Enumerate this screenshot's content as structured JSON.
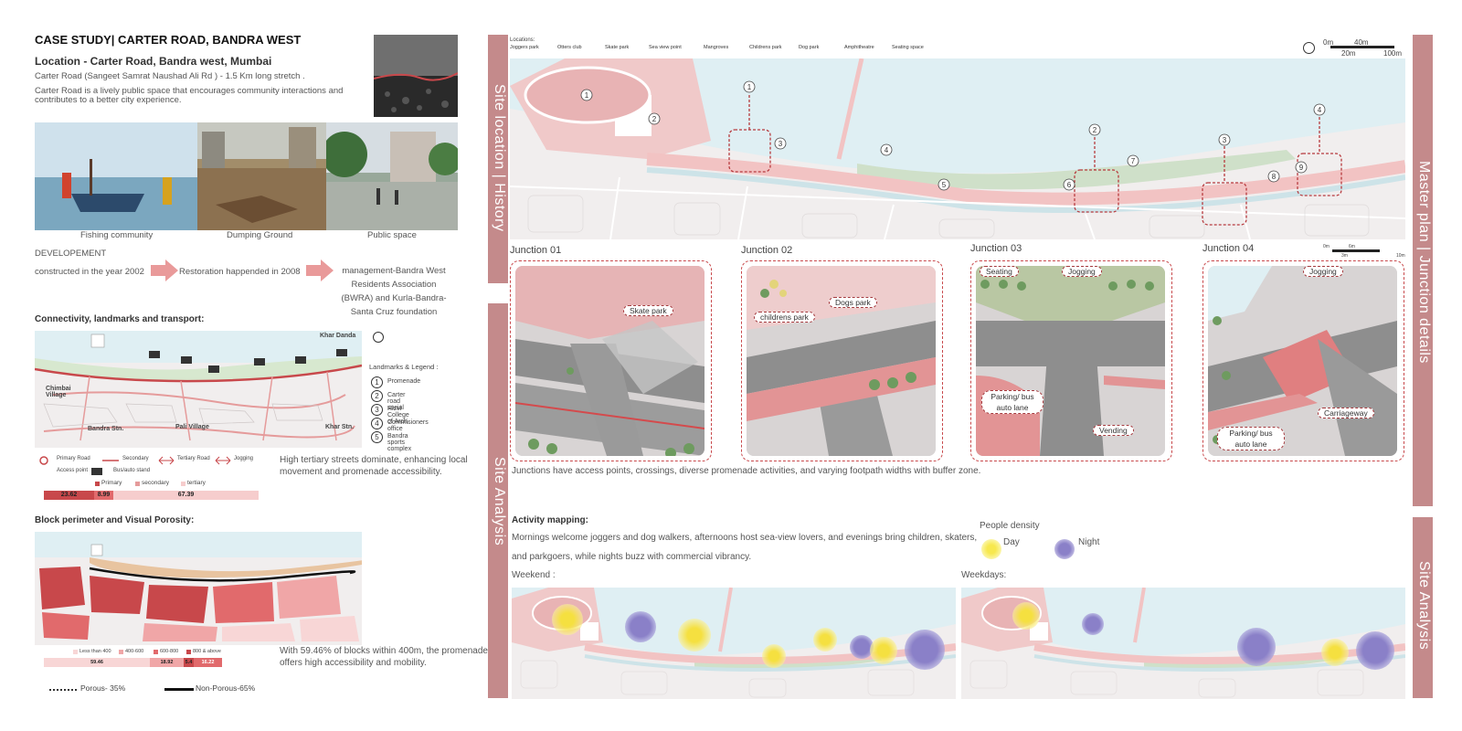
{
  "left": {
    "case_title": "CASE STUDY| CARTER ROAD, BANDRA WEST",
    "location": "Location - Carter Road, Bandra west, Mumbai",
    "road_line": "Carter Road (Sangeet Samrat Naushad Ali Rd ) - 1.5 Km long stretch .",
    "description": "Carter Road is a lively public space that encourages community interactions and contributes to a better city experience.",
    "photos": [
      {
        "caption": "Fishing community"
      },
      {
        "caption": "Dumping Ground"
      },
      {
        "caption": "Public space"
      }
    ],
    "development": {
      "heading": "DEVELOPEMENT",
      "step1": "constructed in the year 2002",
      "step2": "Restoration happended in 2008",
      "step3": "management-Bandra West Residents Association (BWRA) and Kurla-Bandra-Santa Cruz foundation"
    },
    "connectivity": {
      "heading": "Connectivity, landmarks and transport:",
      "legend_title": "Landmarks & Legend :",
      "landmarks": [
        "Promenade",
        "Carter road social",
        "Rizvi College of Arch.",
        "Commisioners office",
        "Bandra sports complex"
      ],
      "map_labels": [
        "Khar Danda",
        "Chimbai Village",
        "Bandra Stn.",
        "Pali Village",
        "Khar Stn."
      ],
      "road_legend": [
        "Primary Road",
        "Secondary",
        "Tertiary Road",
        "Jogging"
      ],
      "access_label": "Access point",
      "bus_label": "Bus/auto stand",
      "bar_legend": [
        "Primary",
        "secondary",
        "tertiary"
      ],
      "bar_values": [
        "23.62",
        "8.99",
        "67.39"
      ],
      "note": "High tertiary streets dominate, enhancing local movement and promenade accessibility."
    },
    "porosity": {
      "heading": "Block perimeter and Visual Porosity:",
      "legend": [
        "Less than 400",
        "400-600",
        "600-800",
        "800 & above"
      ],
      "bar_values": [
        "59.46",
        "18.92",
        "5.4",
        "16.22"
      ],
      "note": "With 59.46% of blocks within 400m, the promenade offers high accessibility and mobility.",
      "porous": "Porous- 35%",
      "non_porous": "Non-Porous-65%"
    }
  },
  "center": {
    "band_top": "Site location | History",
    "band_bottom": "Site Analysis"
  },
  "master": {
    "locations_title": "Locations:",
    "locations": [
      "Joggers park",
      "Otters club",
      "Skate park",
      "Sea view point",
      "Mangroves",
      "Childrens park",
      "Dog park",
      "Amphitheatre",
      "Seating space"
    ],
    "scale_top": [
      "0m",
      "40m"
    ],
    "scale_bottom": [
      "20m",
      "100m"
    ],
    "band": "Master plan | Junction details"
  },
  "junctions": {
    "titles": [
      "Junction 01",
      "Junction 02",
      "Junction 03",
      "Junction 04"
    ],
    "callouts": {
      "j1": [
        "Skate park"
      ],
      "j2": [
        "Dogs park",
        "childrens park"
      ],
      "j3": [
        "Seating",
        "Jogging",
        "Parking/ bus auto lane",
        "Vending"
      ],
      "j4": [
        "Jogging",
        "Carriageway",
        "Parking/ bus auto lane"
      ]
    },
    "scale": [
      "0m",
      "6m",
      "3m",
      "10m"
    ],
    "note": "Junctions have access points, crossings, diverse promenade activities, and varying footpath widths with buffer zone."
  },
  "activity": {
    "heading": "Activity mapping:",
    "text": "Mornings welcome joggers and dog walkers, afternoons host sea-view lovers, and evenings bring children, skaters, and parkgoers, while nights buzz with commercial vibrancy.",
    "density_title": "People density",
    "day": "Day",
    "night": "Night",
    "weekend": "Weekend :",
    "weekdays": "Weekdays:",
    "band": "Site Analysis"
  },
  "colors": {
    "accent": "#c48a8b",
    "red": "#c8484b",
    "day": "#f6e54a",
    "night": "#8a80c8",
    "sea": "#dfeff3",
    "green": "#cfe0c9"
  }
}
